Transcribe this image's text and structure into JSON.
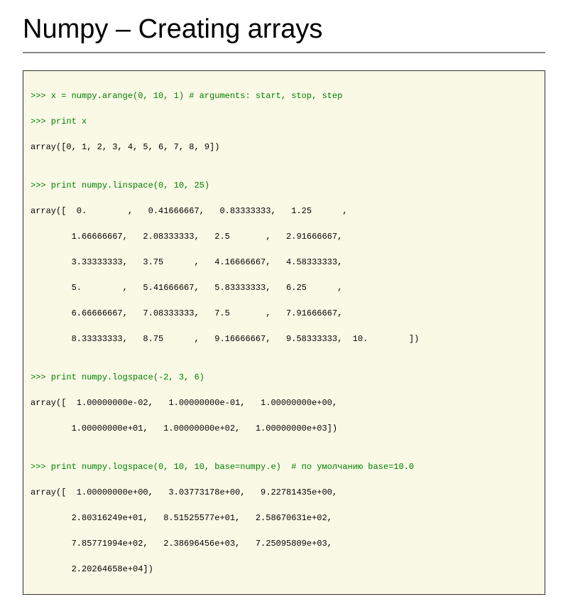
{
  "title": "Numpy – Creating arrays",
  "code": {
    "l1": ">>> x = numpy.arange(0, 10, 1) # arguments: start, stop, step",
    "l2": ">>> print x",
    "l3": "array([0, 1, 2, 3, 4, 5, 6, 7, 8, 9])",
    "l4": "",
    "l5": ">>> print numpy.linspace(0, 10, 25)",
    "l6": "array([  0.        ,   0.41666667,   0.83333333,   1.25      ,",
    "l7": "        1.66666667,   2.08333333,   2.5       ,   2.91666667,",
    "l8": "        3.33333333,   3.75      ,   4.16666667,   4.58333333,",
    "l9": "        5.        ,   5.41666667,   5.83333333,   6.25      ,",
    "l10": "        6.66666667,   7.08333333,   7.5       ,   7.91666667,",
    "l11": "        8.33333333,   8.75      ,   9.16666667,   9.58333333,  10.        ])",
    "l12": "",
    "l13": ">>> print numpy.logspace(-2, 3, 6)",
    "l14": "array([  1.00000000e-02,   1.00000000e-01,   1.00000000e+00,",
    "l15": "        1.00000000e+01,   1.00000000e+02,   1.00000000e+03])",
    "l16": "",
    "l17": ">>> print numpy.logspace(0, 10, 10, base=numpy.e)  # по умолчанию base=10.0",
    "l18": "array([  1.00000000e+00,   3.03773178e+00,   9.22781435e+00,",
    "l19": "        2.80316249e+01,   8.51525577e+01,   2.58670631e+02,",
    "l20": "        7.85771994e+02,   2.38696456e+03,   7.25095809e+03,",
    "l21": "        2.20264658e+04])"
  }
}
